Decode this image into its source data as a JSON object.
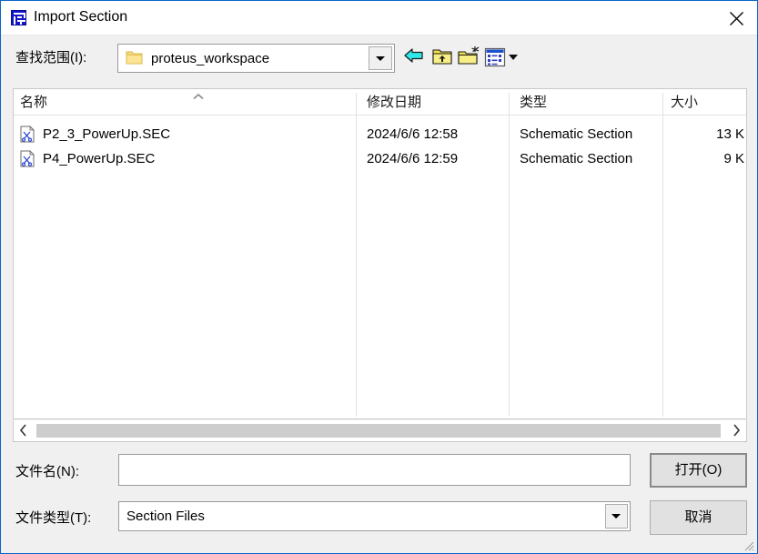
{
  "window": {
    "title": "Import Section",
    "app_icon": "isis-logo-icon",
    "close_label": "close-icon",
    "border_color": "#0a64c8"
  },
  "lookin": {
    "label": "查找范围(I):",
    "value": "proteus_workspace",
    "folder_icon": "folder-icon",
    "dropdown_icon": "chevron-down-icon"
  },
  "toolbar": {
    "buttons": [
      {
        "name": "back-button",
        "icon": "back-arrow-icon"
      },
      {
        "name": "up-one-level-button",
        "icon": "folder-up-icon"
      },
      {
        "name": "create-new-folder-button",
        "icon": "new-folder-icon"
      },
      {
        "name": "views-button",
        "icon": "views-list-icon"
      }
    ]
  },
  "filelist": {
    "columns": [
      {
        "key": "name",
        "label": "名称",
        "sorted": "asc"
      },
      {
        "key": "date",
        "label": "修改日期"
      },
      {
        "key": "type",
        "label": "类型"
      },
      {
        "key": "size",
        "label": "大小"
      }
    ],
    "rows": [
      {
        "icon": "section-file-icon",
        "name": "P2_3_PowerUp.SEC",
        "date": "2024/6/6 12:58",
        "type": "Schematic Section",
        "size": "13 K"
      },
      {
        "icon": "section-file-icon",
        "name": "P4_PowerUp.SEC",
        "date": "2024/6/6 12:59",
        "type": "Schematic Section",
        "size": "9 K"
      }
    ]
  },
  "scrollbar": {
    "left_icon": "chevron-left-icon",
    "right_icon": "chevron-right-icon"
  },
  "filename": {
    "label": "文件名(N):",
    "value": "",
    "placeholder": ""
  },
  "filetype": {
    "label": "文件类型(T):",
    "value": "Section Files",
    "dropdown_icon": "chevron-down-icon"
  },
  "actions": {
    "open_label": "打开(O)",
    "cancel_label": "取消"
  }
}
